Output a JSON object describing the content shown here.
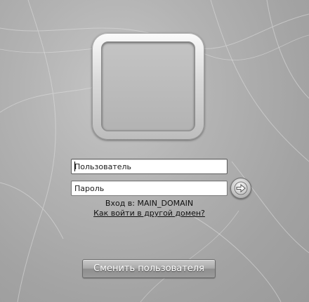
{
  "login": {
    "username_placeholder": "Пользователь",
    "password_placeholder": "Пароль",
    "logon_to_label": "Вход в:",
    "domain_name": "MAIN_DOMAIN",
    "other_domain_link": "Как войти в другой домен?",
    "submit_icon": "arrow-right-icon"
  },
  "footer": {
    "switch_user_label": "Сменить пользователя"
  },
  "colors": {
    "background": "#b3b3b3",
    "tile_frame": "#d9d9d9",
    "text": "#111111"
  }
}
